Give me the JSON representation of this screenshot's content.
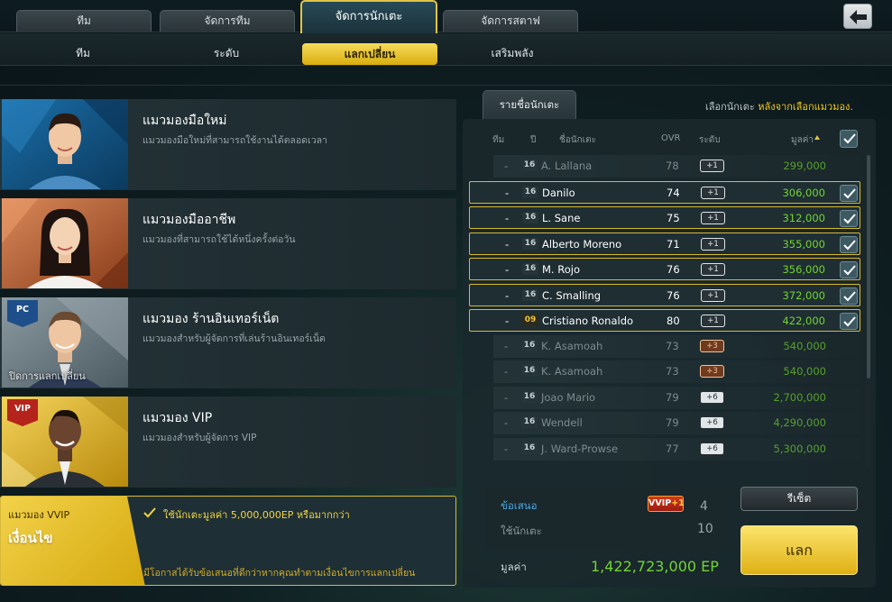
{
  "top_tabs": [
    "ทีม",
    "จัดการทีม",
    "จัดการนักเตะ",
    "จัดการสตาฟ"
  ],
  "sub_tabs": [
    "ทีม",
    "ระดับ",
    "แลกเปลี่ยน",
    "เสริมพลัง"
  ],
  "scouts": [
    {
      "title": "แมวมองมือใหม่",
      "desc": "แมวมองมือใหม่ที่สามารถใช้งานได้ตลอดเวลา"
    },
    {
      "title": "แมวมองมืออาชีพ",
      "desc": "แมวมองที่สามารถใช้ได้หนึ่งครั้งต่อวัน"
    },
    {
      "title": "แมวมอง ร้านอินเทอร์เน็ต",
      "desc": "แมวมองสำหรับผู้จัดการที่เล่นร้านอินเทอร์เน็ต",
      "badge": "PC",
      "closed": "ปิดการแลกเปลี่ยน"
    },
    {
      "title": "แมวมอง VIP",
      "desc": "แมวมองสำหรับผู้จัดการ VIP",
      "badge": "VIP"
    }
  ],
  "vvip": {
    "label": "แมวมอง VVIP",
    "condition": "เงื่อนไข",
    "requirement": "ใช้นักเตะมูลค่า 5,000,000EP หรือมากกว่า",
    "hint": "มีโอกาสได้รับข้อเสนอที่ดีกว่าหากคุณทำตามเงื่อนไขการแลกเปลี่ยน"
  },
  "list": {
    "tab": "รายชื่อนักเตะ",
    "hint_prefix": "เลือกนักเตะ ",
    "hint_highlight": "หลังจากเลือกแมวมอง."
  },
  "table_headers": {
    "team": "ทีม",
    "season": "ปี",
    "name": "ชื่อนักเตะ",
    "ovr": "OVR",
    "grade": "ระดับ",
    "value": "มูลค่า"
  },
  "players": [
    {
      "team": "-",
      "season": "16",
      "name": "A. Lallana",
      "ovr": "78",
      "grade": "+1",
      "value": "299,000",
      "selected": false
    },
    {
      "team": "-",
      "season": "16",
      "name": "Danilo",
      "ovr": "74",
      "grade": "+1",
      "value": "306,000",
      "selected": true
    },
    {
      "team": "-",
      "season": "16",
      "name": "L. Sane",
      "ovr": "75",
      "grade": "+1",
      "value": "312,000",
      "selected": true
    },
    {
      "team": "-",
      "season": "16",
      "name": "Alberto Moreno",
      "ovr": "71",
      "grade": "+1",
      "value": "355,000",
      "selected": true
    },
    {
      "team": "-",
      "season": "16",
      "name": "M. Rojo",
      "ovr": "76",
      "grade": "+1",
      "value": "356,000",
      "selected": true
    },
    {
      "team": "-",
      "season": "16",
      "name": "C. Smalling",
      "ovr": "76",
      "grade": "+1",
      "value": "372,000",
      "selected": true
    },
    {
      "team": "-",
      "season": "09",
      "name": "Cristiano Ronaldo",
      "ovr": "80",
      "grade": "+1",
      "value": "422,000",
      "selected": true
    },
    {
      "team": "-",
      "season": "16",
      "name": "K. Asamoah",
      "ovr": "73",
      "grade": "+3",
      "value": "540,000",
      "selected": false
    },
    {
      "team": "-",
      "season": "16",
      "name": "K. Asamoah",
      "ovr": "73",
      "grade": "+3",
      "value": "540,000",
      "selected": false
    },
    {
      "team": "-",
      "season": "16",
      "name": "Joao Mario",
      "ovr": "79",
      "grade": "+6",
      "value": "2,700,000",
      "selected": false
    },
    {
      "team": "-",
      "season": "16",
      "name": "Wendell",
      "ovr": "79",
      "grade": "+6",
      "value": "4,290,000",
      "selected": false
    },
    {
      "team": "-",
      "season": "16",
      "name": "J. Ward-Prowse",
      "ovr": "77",
      "grade": "+6",
      "value": "5,300,000",
      "selected": false
    }
  ],
  "summary": {
    "offer_label": "ข้อเสนอ",
    "offer_tag": "VVIP",
    "offer_tag_bonus": "+1",
    "offer_count": "4",
    "used_label": "ใช้นักเตะ",
    "used_count": "10",
    "value_label": "มูลค่า",
    "value": "1,422,723,000 EP"
  },
  "buttons": {
    "reset": "รีเซ็ต",
    "trade": "แลก"
  },
  "colors": {
    "gold": "#e2c344",
    "value_green": "#72d334",
    "offer_blue": "#4ea8e0"
  }
}
